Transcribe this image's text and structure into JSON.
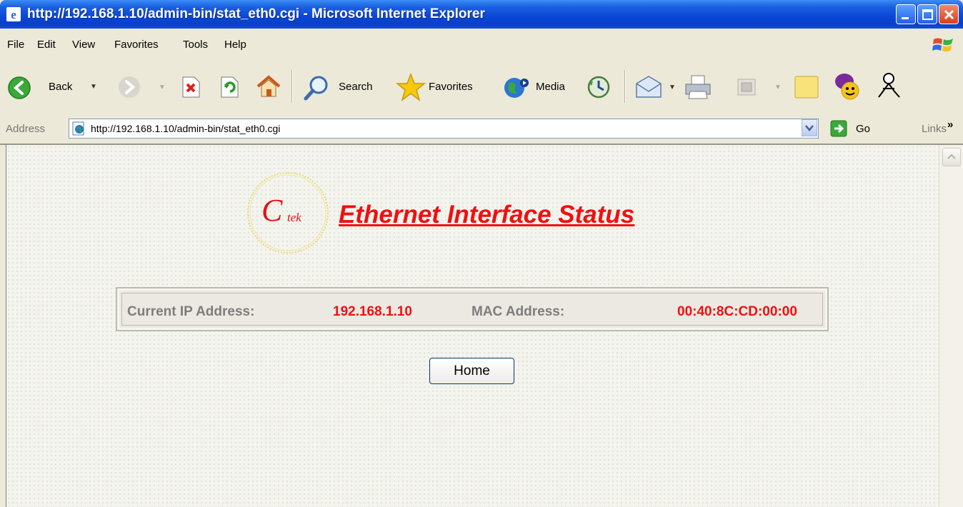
{
  "window": {
    "title": "http://192.168.1.10/admin-bin/stat_eth0.cgi - Microsoft Internet Explorer"
  },
  "menu": [
    "File",
    "Edit",
    "View",
    "Favorites",
    "Tools",
    "Help"
  ],
  "toolbar": {
    "back_label": "Back",
    "search_label": "Search",
    "favorites_label": "Favorites",
    "media_label": "Media"
  },
  "address": {
    "label": "Address",
    "url": "http://192.168.1.10/admin-bin/stat_eth0.cgi",
    "go_label": "Go",
    "links_label": "Links",
    "links_chevron": "»"
  },
  "page": {
    "logo_text": "Ctek",
    "title": "Ethernet Interface Status",
    "ip_label": "Current IP Address:",
    "ip_value": "192.168.1.10",
    "mac_label": "MAC Address:",
    "mac_value": "00:40:8C:CD:00:00",
    "home_button": "Home"
  },
  "colors": {
    "title_red": "#f01010",
    "label_gray": "#7d7d7d",
    "xp_blue": "#0a46d6"
  }
}
